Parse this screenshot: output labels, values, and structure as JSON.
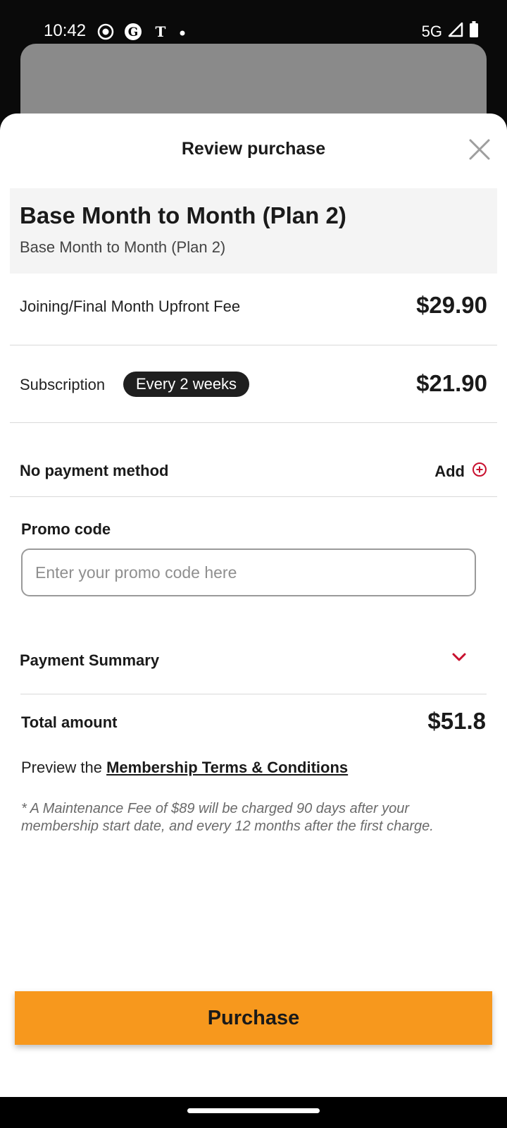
{
  "status_bar": {
    "time": "10:42",
    "network": "5G",
    "icons": [
      "screen-record-icon",
      "guardian-icon",
      "nytimes-icon",
      "notification-dot-icon",
      "signal-icon",
      "battery-icon"
    ]
  },
  "sheet": {
    "title": "Review purchase",
    "close_icon": "close-icon"
  },
  "plan": {
    "name": "Base Month to Month (Plan 2)",
    "subtitle": "Base Month to Month (Plan 2)"
  },
  "fees": {
    "joining_label": "Joining/Final Month Upfront Fee",
    "joining_price": "$29.90",
    "subscription_label": "Subscription",
    "subscription_badge": "Every 2 weeks",
    "subscription_price": "$21.90"
  },
  "payment_method": {
    "label": "No payment method",
    "add_label": "Add",
    "add_icon": "plus-circle-icon"
  },
  "promo": {
    "label": "Promo code",
    "placeholder": "Enter your promo code here",
    "value": ""
  },
  "summary": {
    "label": "Payment Summary",
    "chevron_icon": "chevron-down-icon",
    "total_label": "Total amount",
    "total_value": "$51.8"
  },
  "terms": {
    "prefix": "Preview the",
    "link_label": "Membership Terms & Conditions"
  },
  "note": "* A Maintenance Fee of $89 will be charged 90 days after your membership start date, and every 12 months after the first charge.",
  "actions": {
    "purchase_label": "Purchase"
  },
  "colors": {
    "accent": "#f7981d",
    "icon_red": "#c8102e",
    "badge_bg": "#1f1f1f"
  }
}
